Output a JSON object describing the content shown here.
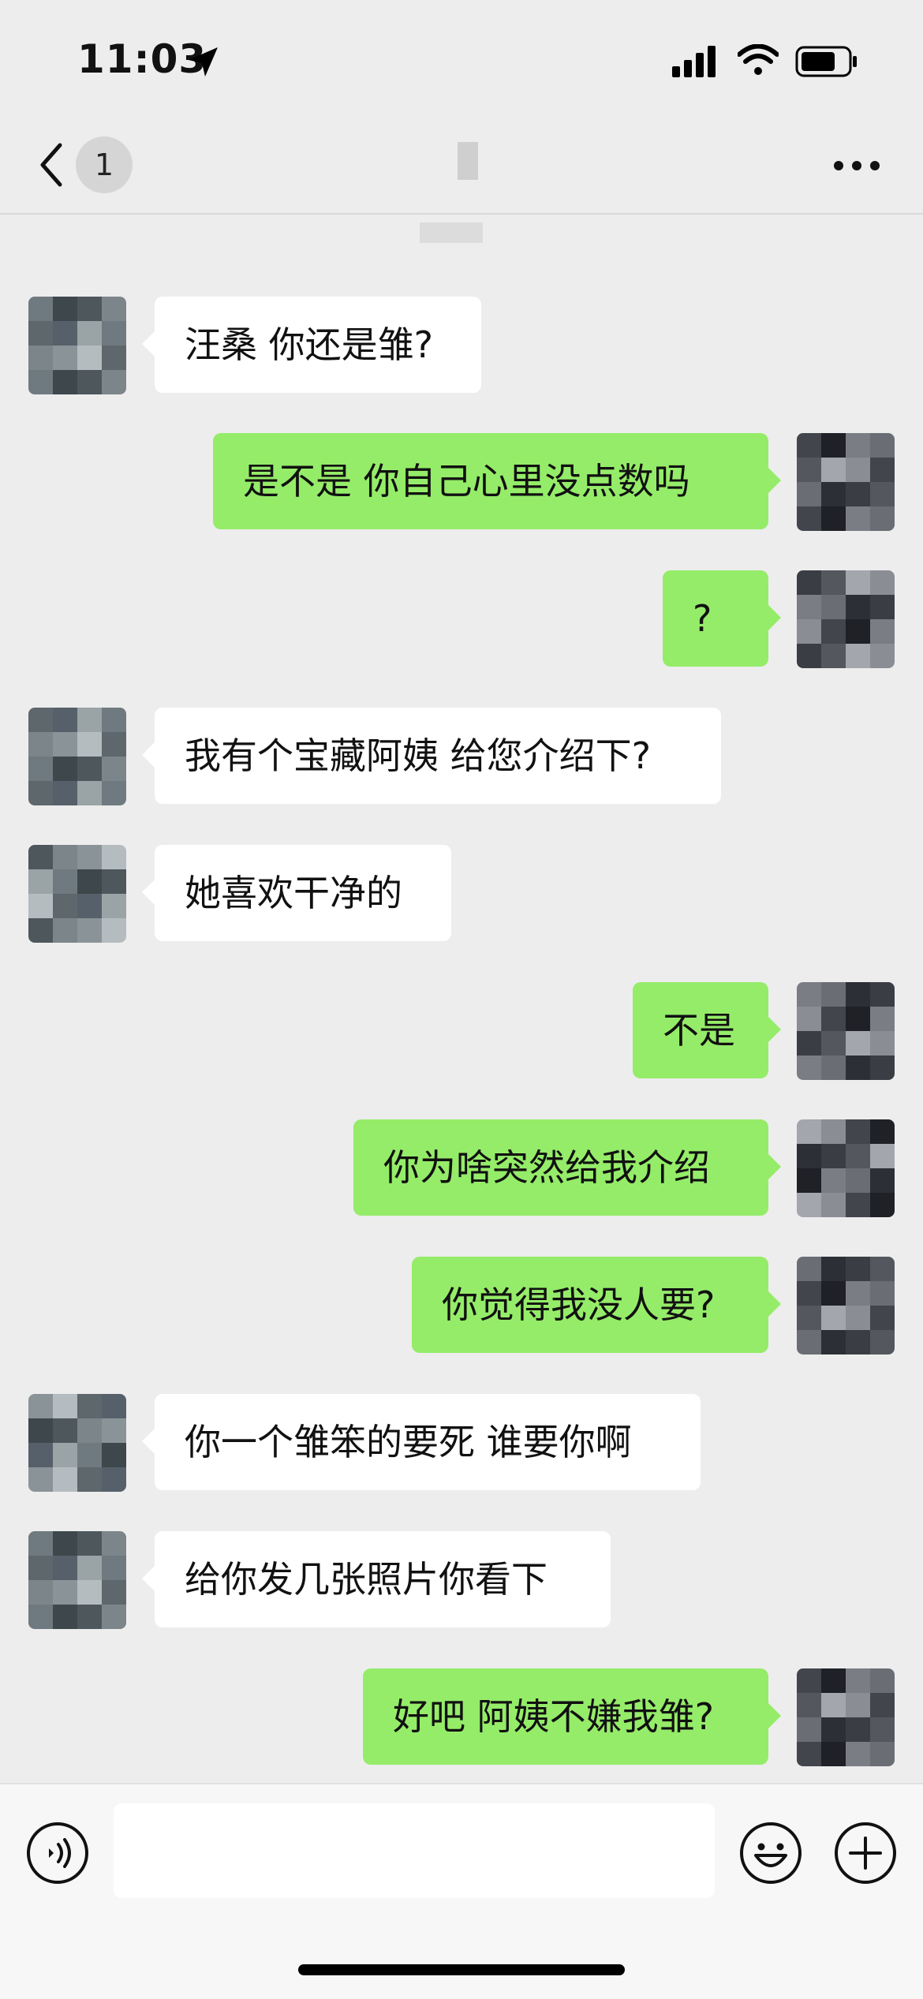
{
  "status_bar": {
    "time": "11:03"
  },
  "nav": {
    "unread_count": "1"
  },
  "messages": [
    {
      "side": "in",
      "text": "汪桑 你还是雏?"
    },
    {
      "side": "out",
      "text": "是不是 你自己心里没点数吗"
    },
    {
      "side": "out",
      "text": "?"
    },
    {
      "side": "in",
      "text": "我有个宝藏阿姨 给您介绍下?"
    },
    {
      "side": "in",
      "text": "她喜欢干净的"
    },
    {
      "side": "out",
      "text": "不是"
    },
    {
      "side": "out",
      "text": "你为啥突然给我介绍"
    },
    {
      "side": "out",
      "text": "你觉得我没人要?"
    },
    {
      "side": "in",
      "text": "你一个雏笨的要死 谁要你啊"
    },
    {
      "side": "in",
      "text": "给你发几张照片你看下"
    },
    {
      "side": "out",
      "text": "好吧 阿姨不嫌我雏?"
    }
  ],
  "icons": {
    "location": "location-arrow-icon",
    "signal": "cellular-signal-icon",
    "wifi": "wifi-icon",
    "battery": "battery-icon",
    "back": "chevron-left-icon",
    "more": "more-dots-icon",
    "voice": "voice-input-icon",
    "emoji": "emoji-icon",
    "plus": "plus-icon"
  },
  "colors": {
    "incoming_bubble": "#ffffff",
    "outgoing_bubble": "#95ec69",
    "background": "#ededed"
  }
}
